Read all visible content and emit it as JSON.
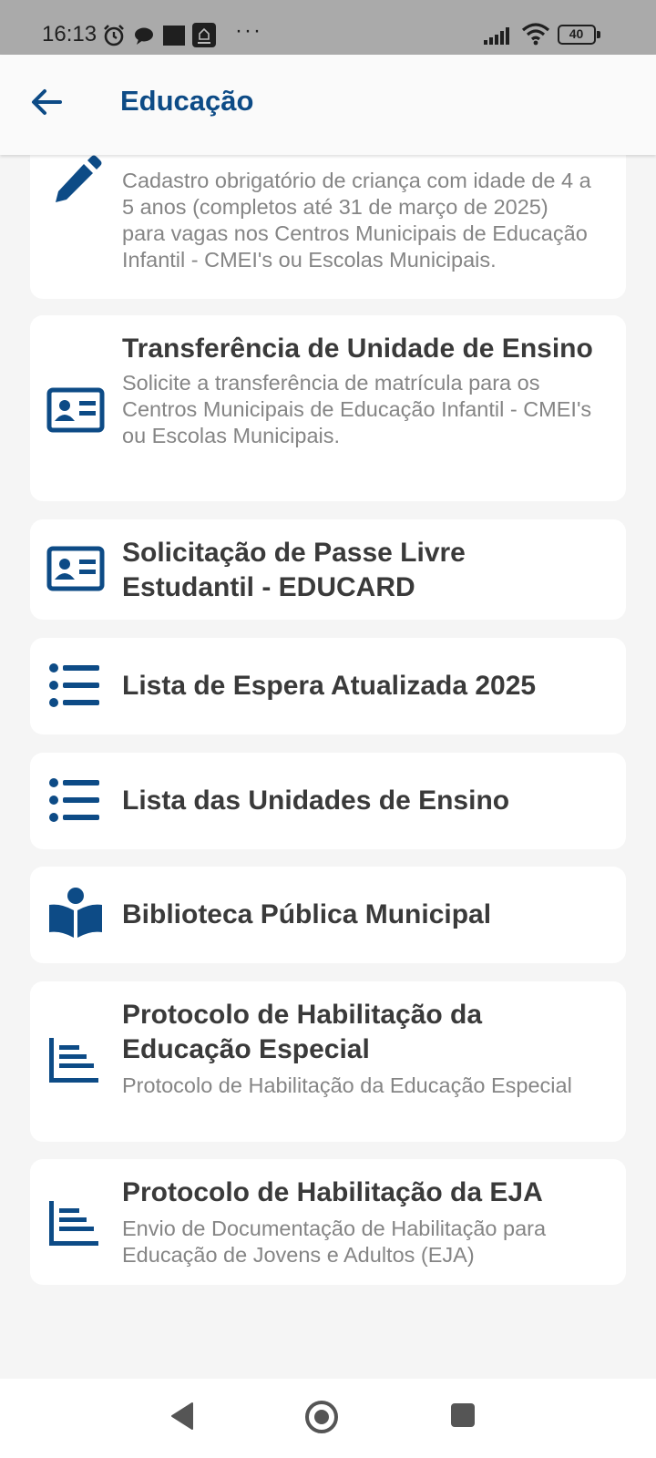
{
  "status_bar": {
    "time": "16:13",
    "more": "···",
    "battery": "40"
  },
  "header": {
    "title": "Educação"
  },
  "colors": {
    "accent": "#0d4b86",
    "title_text": "#3a3a3a",
    "description_text": "#858585"
  },
  "services": [
    {
      "icon": "pencil-icon",
      "title": "",
      "description": "Cadastro obrigatório de criança com idade de 4 a 5 anos (completos até 31 de março de 2025) para vagas nos Centros Municipais de Educação Infantil - CMEI's ou Escolas Municipais."
    },
    {
      "icon": "id-card-icon",
      "title": "Transferência de Unidade de Ensino",
      "description": "Solicite a transferência de matrícula para os Centros Municipais de Educação Infantil - CMEI's ou Escolas Municipais."
    },
    {
      "icon": "id-card-icon",
      "title": "Solicitação de Passe Livre Estudantil - EDUCARD",
      "description": ""
    },
    {
      "icon": "list-icon",
      "title": "Lista de Espera Atualizada 2025",
      "description": ""
    },
    {
      "icon": "list-icon",
      "title": "Lista das Unidades de Ensino",
      "description": ""
    },
    {
      "icon": "book-reader-icon",
      "title": "Biblioteca Pública Municipal",
      "description": ""
    },
    {
      "icon": "align-left-icon",
      "title": "Protocolo de Habilitação da Educação Especial",
      "description": "Protocolo de Habilitação da Educação Especial"
    },
    {
      "icon": "align-left-icon",
      "title": "Protocolo de Habilitação da EJA",
      "description": "Envio de Documentação de Habilitação para Educação de Jovens e Adultos (EJA)"
    }
  ],
  "nav_bar": {
    "back": "back-triangle-icon",
    "home": "home-circle-icon",
    "recents": "recents-square-icon"
  }
}
